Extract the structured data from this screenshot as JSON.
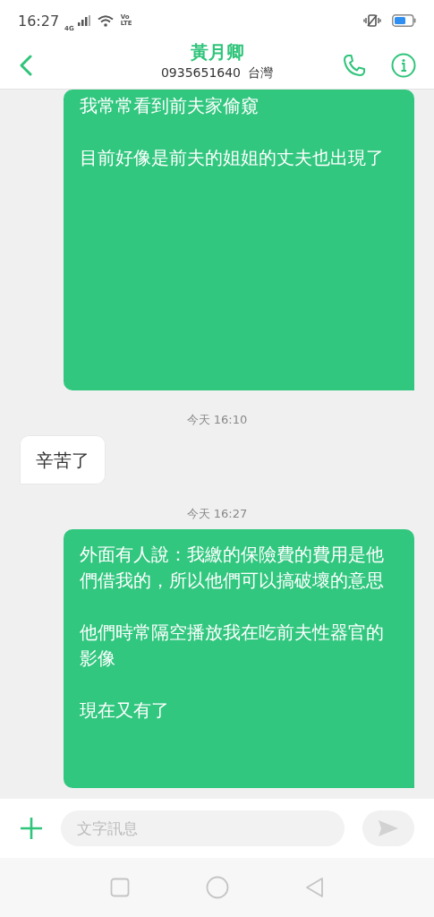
{
  "status_bar": {
    "time": "16:27",
    "network": "4G",
    "volte": [
      "Vo",
      "LTE"
    ]
  },
  "header": {
    "title": "黃月卿",
    "phone": "0935651640",
    "region": "台灣"
  },
  "messages": [
    {
      "kind": "sent",
      "paragraphs": [
        "我常常看到前夫家偷窺",
        "目前好像是前夫的姐姐的丈夫也出現了"
      ]
    },
    {
      "kind": "time",
      "text": "今天 16:10"
    },
    {
      "kind": "received",
      "text": "辛苦了"
    },
    {
      "kind": "time",
      "text": "今天 16:27"
    },
    {
      "kind": "sent",
      "paragraphs": [
        "外面有人說：我繳的保險費的費用是他們借我的，所以他們可以搞破壞的意思",
        "他們時常隔空播放我在吃前夫性器官的影像",
        "現在又有了"
      ]
    }
  ],
  "composer": {
    "placeholder": "文字訊息"
  }
}
